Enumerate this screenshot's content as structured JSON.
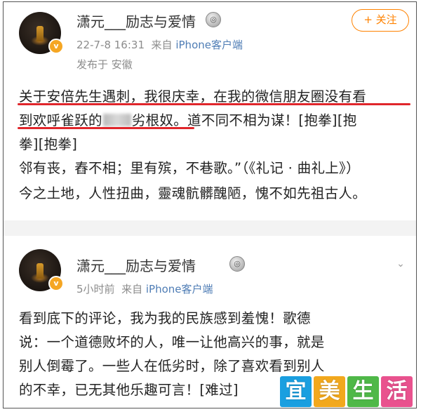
{
  "post1": {
    "username": "潇元___励志与爱情",
    "timestamp": "22-7-8 16:31",
    "from_prefix": "来自",
    "client": "iPhone客户端",
    "location": "发布于 安徽",
    "follow_label": "+ 关注",
    "lines": [
      "关于安倍先生遇刺，我很庆幸，在我的微信朋友圈没有看",
      "到欢呼雀跃的",
      "劣根奴。道不同不相为谋！[抱拳][抱",
      "拳][抱拳]",
      "邻有丧，舂不相；里有殡，不巷歌。”（《礼记 · 曲礼上》）",
      "今之土地，人性扭曲，靈魂骯髒醜陋，愧不如先祖古人。"
    ]
  },
  "post2": {
    "username": "潇元___励志与爱情",
    "timestamp": "5小时前",
    "from_prefix": "来自",
    "client": "iPhone客户端",
    "lines": [
      "看到底下的评论，我为我的民族感到羞愧！歌德",
      "说：一个道德败坏的人，唯一让他高兴的事，就是",
      "别人倒霉了。一些人在低劣时，除了喜欢看到别人",
      "的不幸，已无其他乐趣可言！[难过]"
    ]
  },
  "watermark": [
    "宜",
    "美",
    "生",
    "活"
  ],
  "colors": {
    "underline": "#e0262b",
    "follow": "#ff8200",
    "client_link": "#4f7db5",
    "watermark": [
      "#1a9fe0",
      "#f2a81d",
      "#4fb848",
      "#e9528e"
    ]
  }
}
